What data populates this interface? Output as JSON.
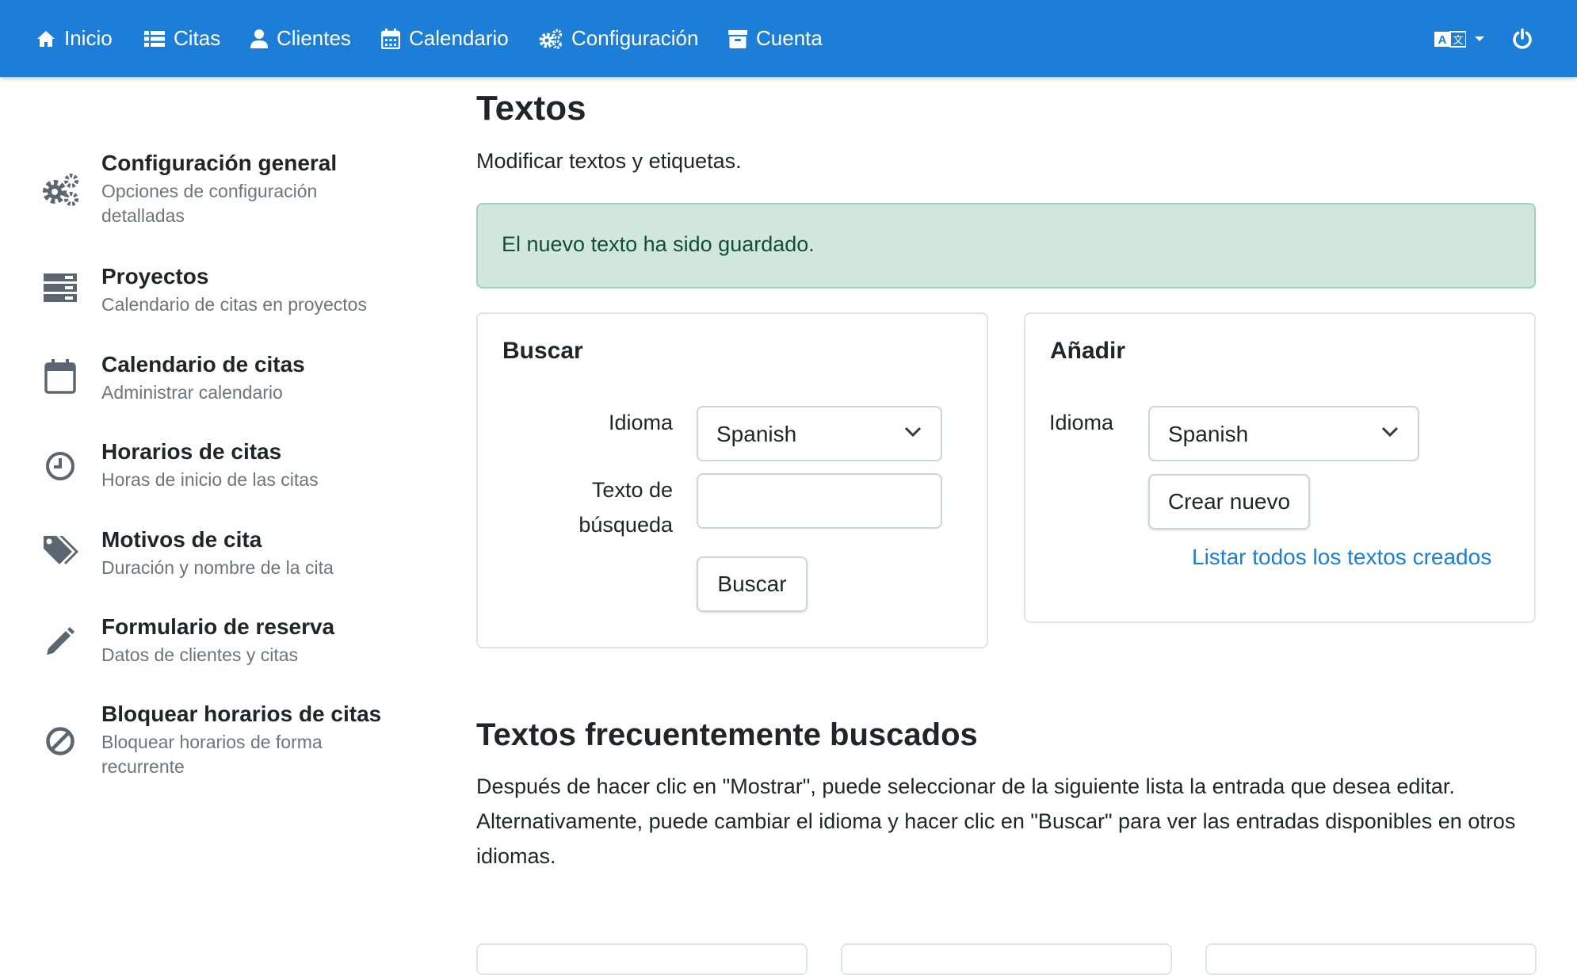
{
  "nav": {
    "items": [
      {
        "label": "Inicio",
        "icon": "home-icon"
      },
      {
        "label": "Citas",
        "icon": "list-icon"
      },
      {
        "label": "Clientes",
        "icon": "user-icon"
      },
      {
        "label": "Calendario",
        "icon": "calendar-icon"
      },
      {
        "label": "Configuración",
        "icon": "gears-icon"
      },
      {
        "label": "Cuenta",
        "icon": "archive-icon"
      }
    ],
    "language_icon": "language-icon",
    "power_icon": "power-icon",
    "bar_color": "#1c7ed6"
  },
  "sidebar": {
    "items": [
      {
        "title": "Configuración general",
        "subtitle": "Opciones de configuración detalladas",
        "icon": "gears-icon"
      },
      {
        "title": "Proyectos",
        "subtitle": "Calendario de citas en proyectos",
        "icon": "server-icon"
      },
      {
        "title": "Calendario de citas",
        "subtitle": "Administrar calendario",
        "icon": "calendar-icon"
      },
      {
        "title": "Horarios de citas",
        "subtitle": "Horas de inicio de las citas",
        "icon": "clock-icon"
      },
      {
        "title": "Motivos de cita",
        "subtitle": "Duración y nombre de la cita",
        "icon": "tags-icon"
      },
      {
        "title": "Formulario de reserva",
        "subtitle": "Datos de clientes y citas",
        "icon": "pencil-icon"
      },
      {
        "title": "Bloquear horarios de citas",
        "subtitle": "Bloquear horarios de forma recurrente",
        "icon": "ban-icon"
      }
    ]
  },
  "main": {
    "title": "Textos",
    "subtitle": "Modificar textos y etiquetas.",
    "alert": "El nuevo texto ha sido guardado.",
    "search_card": {
      "title": "Buscar",
      "language_label": "Idioma",
      "language_value": "Spanish",
      "search_label_line1": "Texto de",
      "search_label_line2": "búsqueda",
      "search_value": "",
      "button": "Buscar"
    },
    "add_card": {
      "title": "Añadir",
      "language_label": "Idioma",
      "language_value": "Spanish",
      "button": "Crear nuevo",
      "link": "Listar todos los textos creados"
    },
    "frequent": {
      "title": "Textos frecuentemente buscados",
      "text": "Después de hacer clic en \"Mostrar\", puede seleccionar de la siguiente lista la entrada que desea editar. Alternativamente, puede cambiar el idioma y hacer clic en \"Buscar\" para ver las entradas disponibles en otros idiomas."
    }
  }
}
